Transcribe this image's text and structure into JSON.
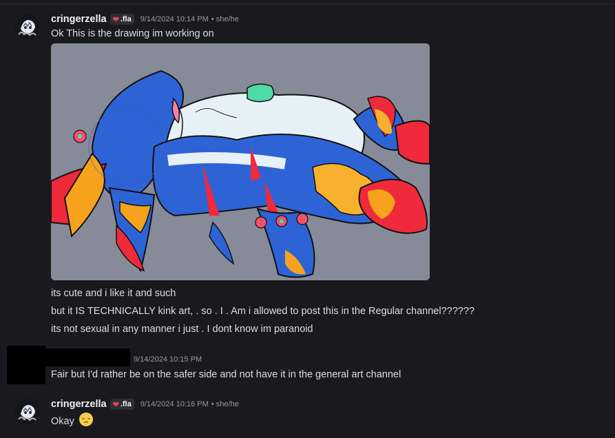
{
  "messages": [
    {
      "author": "cringerzella",
      "tag": ".fla",
      "timestamp": "9/14/2024 10:14 PM",
      "pronouns": "• she/he",
      "lines": [
        "Ok This is the drawing im working on"
      ]
    },
    {
      "continuation_lines": [
        "its cute and i like it and such",
        "but it IS TECHNICALLY kink art, . so . I . Am i allowed to post this in the Regular channel??????",
        "its not sexual in any manner i just . I dont know im paranoid"
      ]
    },
    {
      "author": "",
      "timestamp": "9/14/2024 10:15 PM",
      "lines": [
        "Fair but I'd rather be on the safer side and not have it  in the general art channel"
      ]
    },
    {
      "author": "cringerzella",
      "tag": ".fla",
      "timestamp": "9/14/2024 10:16 PM",
      "pronouns": "• she/he",
      "lines": [
        "Okay"
      ]
    }
  ],
  "icons": {
    "tag_icon": "heart-icon",
    "emoji": "pensive-face-emoji"
  },
  "colors": {
    "background": "#1a1a1e",
    "username": "#f2f3f5",
    "timestamp": "#949ba4",
    "tag_heart": "#f23f5c"
  }
}
